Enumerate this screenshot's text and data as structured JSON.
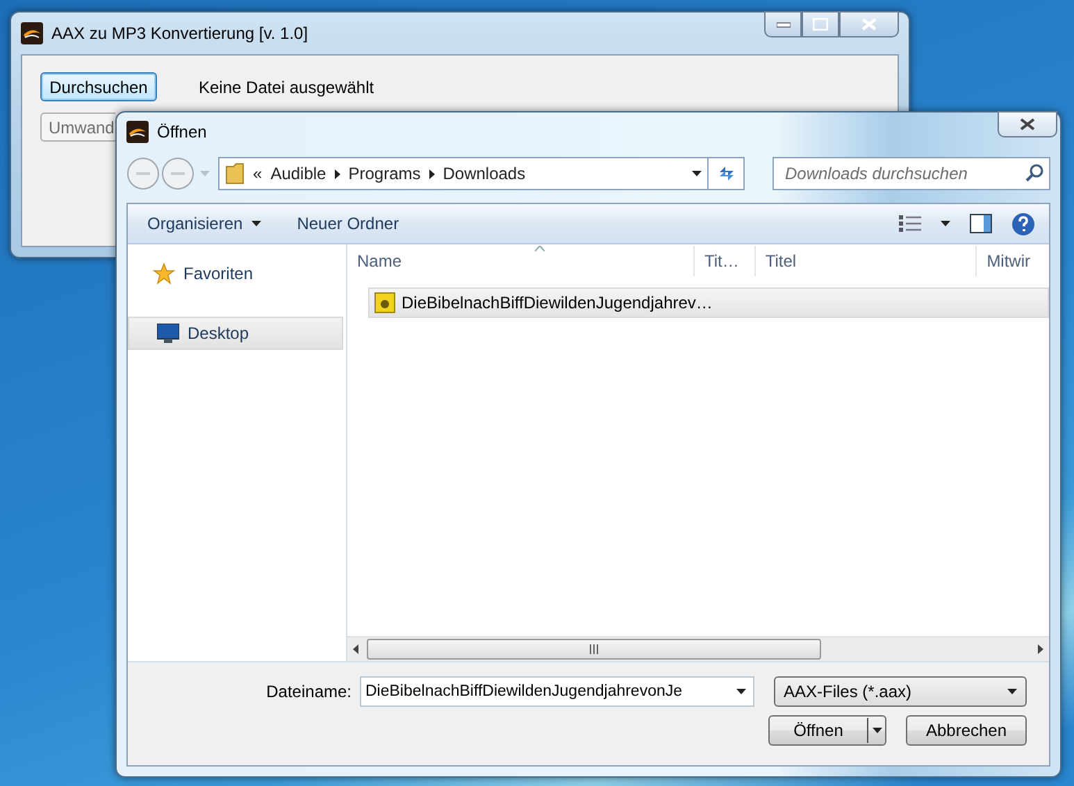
{
  "background_window": {
    "title": "AAX zu MP3 Konvertierung [v. 1.0]",
    "status_text": "Keine Datei ausgewählt",
    "buttons": [
      {
        "label": "Durchsuchen",
        "disabled": false
      },
      {
        "label": "Umwand",
        "disabled": true
      }
    ]
  },
  "dialog": {
    "title": "Öffnen",
    "overflow_mark": "«",
    "breadcrumb": [
      "Audible",
      "Programs",
      "Downloads"
    ],
    "search": {
      "placeholder": "Downloads durchsuchen"
    },
    "toolbar": [
      {
        "label": "Organisieren",
        "kind": "menu"
      },
      {
        "label": "Neuer Ordner",
        "kind": "plain"
      }
    ],
    "sidebar": {
      "items": [
        {
          "label": "Favoriten",
          "kind": "favorites",
          "selected": false
        },
        {
          "label": "Desktop",
          "kind": "desktop",
          "selected": true
        }
      ]
    },
    "columns": [
      "Name",
      "Tit…",
      "Titel",
      "Mitwir"
    ],
    "files": [
      {
        "name": "DieBibelnachBiffDiewildenJugendjahrev…",
        "selected": true
      }
    ],
    "filename_label": "Dateiname:",
    "filename_value": "DieBibelnachBiffDiewildenJugendjahrevonJe",
    "file_type": "AAX-Files (*.aax)",
    "buttons": [
      {
        "label": "Öffnen",
        "kind": "split"
      },
      {
        "label": "Abbrechen",
        "kind": "plain"
      }
    ]
  }
}
